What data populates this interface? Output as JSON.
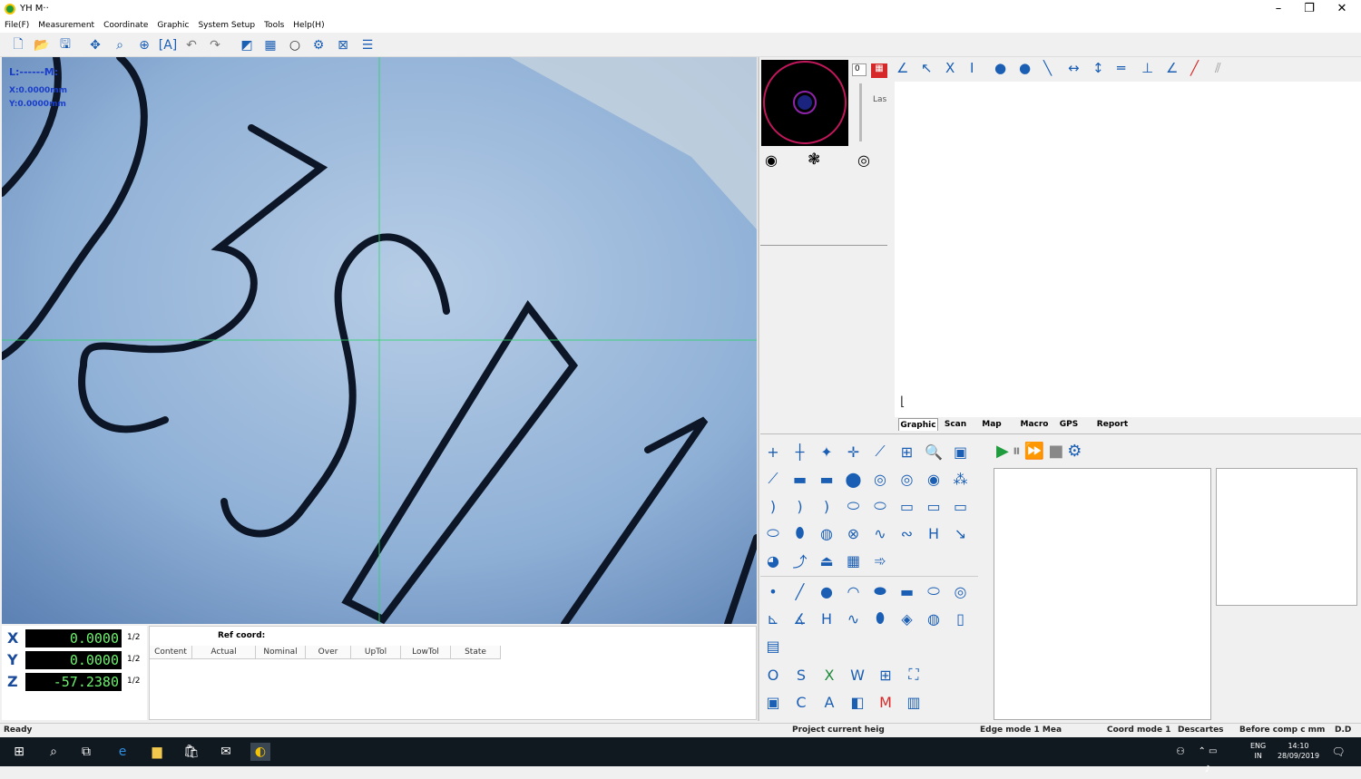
{
  "window": {
    "title": "YH M··"
  },
  "menu": [
    "File(F)",
    "Measurement",
    "Coordinate",
    "Graphic",
    "System Setup",
    "Tools",
    "Help(H)"
  ],
  "camera_overlay": {
    "line1": "L:------M:",
    "x_text": "X:0.0000mm",
    "y_text": "Y:0.0000mm"
  },
  "coords": {
    "x_label": "X",
    "x_value": "0.0000",
    "x_half": "1/2",
    "y_label": "Y",
    "y_value": "0.0000",
    "y_half": "1/2",
    "z_label": "Z",
    "z_value": "-57.2380",
    "z_half": "1/2"
  },
  "result_table": {
    "title": "Ref coord:",
    "columns": [
      "Content",
      "Actual",
      "Nominal",
      "Over",
      "UpTol",
      "LowTol",
      "State"
    ]
  },
  "preview_panel": {
    "spin_value": "0",
    "side_label": "Las"
  },
  "graph_tabs": [
    "Graphic",
    "Scan",
    "Map",
    "Macro",
    "GPS",
    "Report"
  ],
  "status": {
    "ready": "Ready",
    "project": "Project current heig",
    "edge": "Edge mode 1 Mea",
    "coord_mode": "Coord mode 1",
    "cartesian": "Descartes",
    "comp": "Before comp c mm",
    "dd": "D.D"
  },
  "taskbar": {
    "lang1": "ENG",
    "lang2": "IN",
    "time": "14:10",
    "date": "28/09/2019"
  },
  "colors": {
    "accent": "#1b5fb4",
    "readout_green": "#6df06d",
    "taskbar": "#101820"
  }
}
